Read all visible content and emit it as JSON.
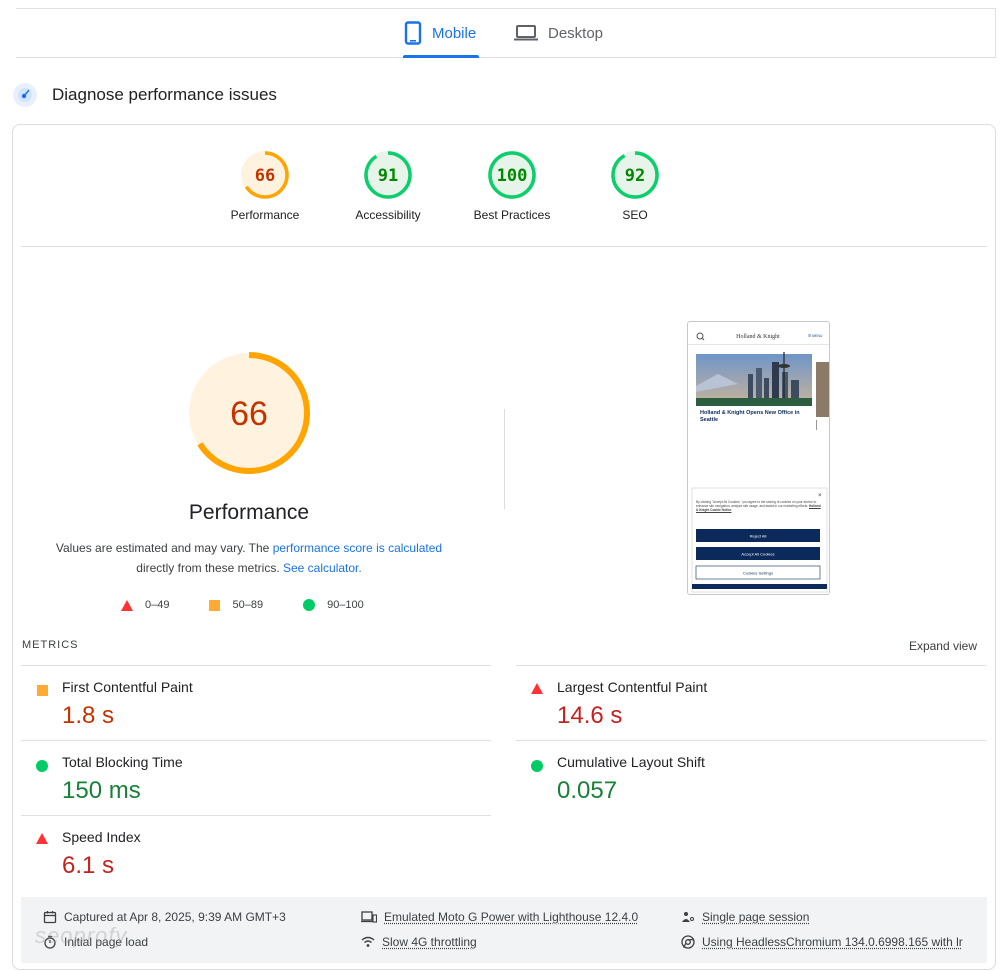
{
  "tabs": {
    "mobile_label": "Mobile",
    "desktop_label": "Desktop"
  },
  "diagnose_title": "Diagnose performance issues",
  "scores": [
    {
      "label": "Performance",
      "value": "66",
      "score": 66,
      "color": "#ffa400",
      "text_color": "#c33300",
      "bg": "#fff3e0"
    },
    {
      "label": "Accessibility",
      "value": "91",
      "score": 91,
      "color": "#0cce6b",
      "text_color": "#008800",
      "bg": "#e6f4ea"
    },
    {
      "label": "Best Practices",
      "value": "100",
      "score": 100,
      "color": "#0cce6b",
      "text_color": "#008800",
      "bg": "#e6f4ea"
    },
    {
      "label": "SEO",
      "value": "92",
      "score": 92,
      "color": "#0cce6b",
      "text_color": "#008800",
      "bg": "#e6f4ea"
    }
  ],
  "performance": {
    "score": "66",
    "score_fraction": 0.66,
    "title": "Performance",
    "desc_1": "Values are estimated and may vary. The",
    "desc_link_1": "performance score is calculated",
    "desc_2": "directly from these metrics.",
    "desc_link_2": "See calculator."
  },
  "legend": {
    "poor": "0–49",
    "average": "50–89",
    "good": "90–100"
  },
  "screenshot": {
    "brand": "Holland & Knight",
    "menu": "☰ MENU",
    "headline": "Holland & Knight Opens New Office in Seattle",
    "cookie_text": "By clicking \"Accept All Cookies,\" you agree to the storing of cookies on your device to enhance site navigation, analyze site usage, and assist in our marketing efforts.",
    "cookie_link": "Holland & Knight Cookie Notice",
    "reject_all": "Reject All",
    "accept_all": "Accept All Cookies",
    "cookie_settings": "Cookies Settings"
  },
  "metrics_label": "METRICS",
  "expand_view": "Expand view",
  "metrics": [
    {
      "name": "First Contentful Paint",
      "value": "1.8 s",
      "rating": "average"
    },
    {
      "name": "Largest Contentful Paint",
      "value": "14.6 s",
      "rating": "poor"
    },
    {
      "name": "Total Blocking Time",
      "value": "150 ms",
      "rating": "good"
    },
    {
      "name": "Cumulative Layout Shift",
      "value": "0.057",
      "rating": "good"
    },
    {
      "name": "Speed Index",
      "value": "6.1 s",
      "rating": "poor"
    }
  ],
  "footer": {
    "captured": "Captured at Apr 8, 2025, 9:39 AM GMT+3",
    "initial_load": "Initial page load",
    "device": "Emulated Moto G Power with Lighthouse 12.4.0",
    "throttling": "Slow 4G throttling",
    "session": "Single page session",
    "browser": "Using HeadlessChromium 134.0.6998.165 with lr"
  },
  "watermark": "seoprofy",
  "colors": {
    "accent": "#1a73e8",
    "poor": "#ff3333",
    "average": "#ffaa33",
    "good": "#00cc66"
  }
}
